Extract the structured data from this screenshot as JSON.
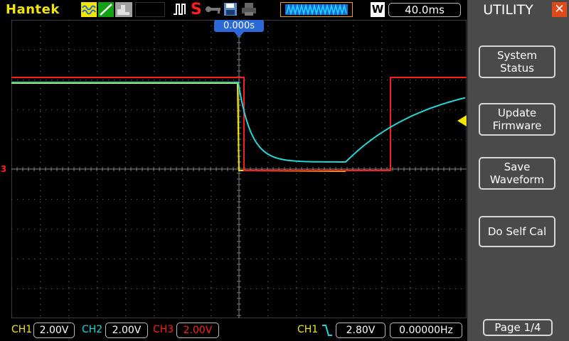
{
  "brand": "Hantek",
  "toolbar": {
    "icons": [
      "mode-waveform-icon",
      "line-display-icon",
      "peak-icon",
      "trigger-edge-icon",
      "stop-icon",
      "key-icon",
      "save-icon",
      "printer-icon"
    ],
    "run_state": "S",
    "mode_letter": "W",
    "timebase": "40.0ms"
  },
  "trigger_position": "0.000s",
  "channel3_marker": "3",
  "menu": {
    "title": "UTILITY",
    "close_icon": "close-icon",
    "buttons": [
      {
        "label": "System\nStatus"
      },
      {
        "label": "Update\nFirmware"
      },
      {
        "label": "Save\nWaveform"
      },
      {
        "label": "Do Self Cal"
      }
    ],
    "page": "Page 1/4"
  },
  "statusbar": {
    "ch1_label": "CH1",
    "ch1_scale": "2.00V",
    "ch2_label": "CH2",
    "ch2_scale": "2.00V",
    "ch3_label": "CH3",
    "ch3_scale": "2.00V",
    "trigger_source": "CH1",
    "trigger_level": "2.80V",
    "frequency": "0.00000Hz"
  },
  "colors": {
    "ch1": "#f2e600",
    "ch2": "#20d8d8",
    "ch3": "#ff1e1e",
    "accent": "#2a6ad8",
    "menu_bg": "#4a4a4a"
  }
}
